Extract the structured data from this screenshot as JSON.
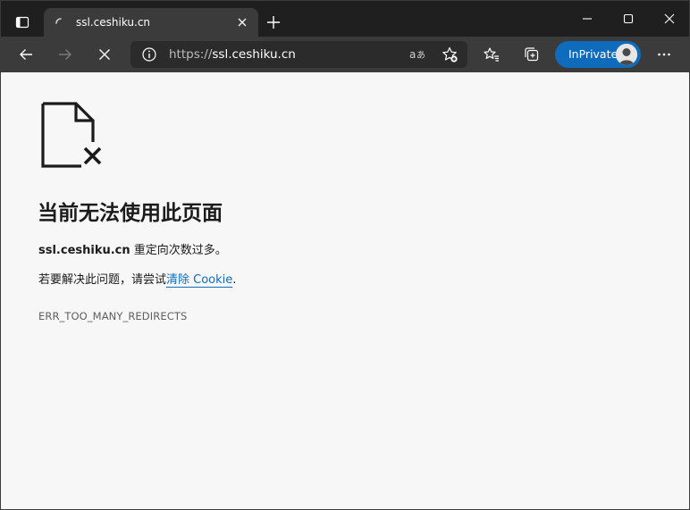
{
  "tab": {
    "title": "ssl.ceshiku.cn"
  },
  "toolbar": {
    "url_scheme": "https://",
    "url_host": "ssl.ceshiku.cn",
    "inprivate_label": "InPrivate"
  },
  "error": {
    "title": "当前无法使用此页面",
    "host": "ssl.ceshiku.cn",
    "message": " 重定向次数过多。",
    "suggestion_prefix": "若要解决此问题，请尝试",
    "suggestion_link": "清除 Cookie",
    "suggestion_suffix": ".",
    "code": "ERR_TOO_MANY_REDIRECTS"
  },
  "icons": {
    "tab_actions": "tab-actions-icon",
    "loading": "loading-spinner-icon",
    "tab_close": "close-icon",
    "new_tab": "plus-icon",
    "minimize": "minimize-icon",
    "maximize": "maximize-icon",
    "window_close": "close-icon",
    "back": "arrow-left-icon",
    "forward": "arrow-right-icon",
    "stop": "stop-icon",
    "site_info": "info-icon",
    "read_aloud": "read-aloud-icon",
    "add_favorite": "star-add-icon",
    "favorites": "favorites-icon",
    "collections": "collections-icon",
    "profile": "avatar-icon",
    "menu": "more-icon",
    "error_page": "document-error-icon"
  },
  "colors": {
    "titlebar": "#1f1f1f",
    "toolbar": "#3b3b3b",
    "addressbar": "#2b2b2b",
    "inprivate": "#0f6cbd",
    "link": "#0f6cbd",
    "page_bg": "#f7f7f7"
  }
}
